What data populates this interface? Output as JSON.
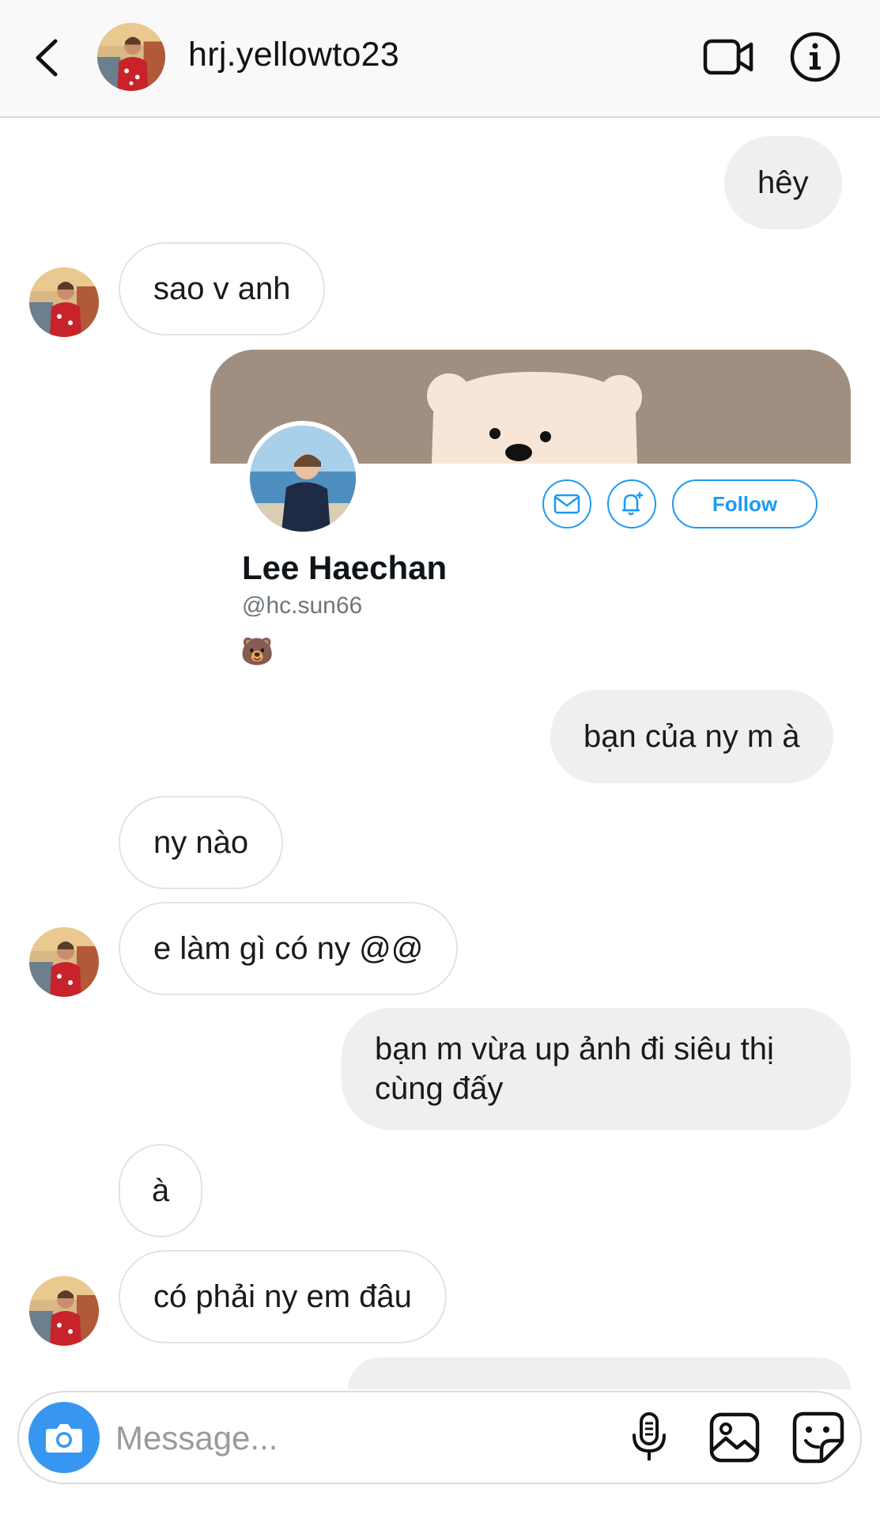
{
  "header": {
    "username": "hrj.yellowto23",
    "icons": [
      "back-chevron-icon",
      "video-call-icon",
      "info-icon"
    ]
  },
  "messages": [
    {
      "side": "out",
      "text": "hêy"
    },
    {
      "side": "in",
      "text": "sao v anh"
    },
    {
      "side": "out",
      "type": "shared-profile"
    },
    {
      "side": "out",
      "text": "bạn của ny m à"
    },
    {
      "side": "in",
      "text": "ny nào"
    },
    {
      "side": "in",
      "text": "e làm gì có ny @@"
    },
    {
      "side": "out",
      "text": "bạn m vừa up ảnh đi siêu thị cùng đấy"
    },
    {
      "side": "in",
      "text": "à"
    },
    {
      "side": "in",
      "text": "có phải ny em đâu"
    }
  ],
  "shared_profile": {
    "name": "Lee Haechan",
    "handle": "@hc.sun66",
    "bio": "🐻",
    "follow_label": "Follow",
    "accent_color": "#1d9bf0",
    "banner_color": "#a08f80"
  },
  "composer": {
    "placeholder": "Message...",
    "icons": [
      "camera-icon",
      "microphone-icon",
      "gallery-icon",
      "sticker-icon"
    ],
    "accent_color": "#3797f0"
  }
}
